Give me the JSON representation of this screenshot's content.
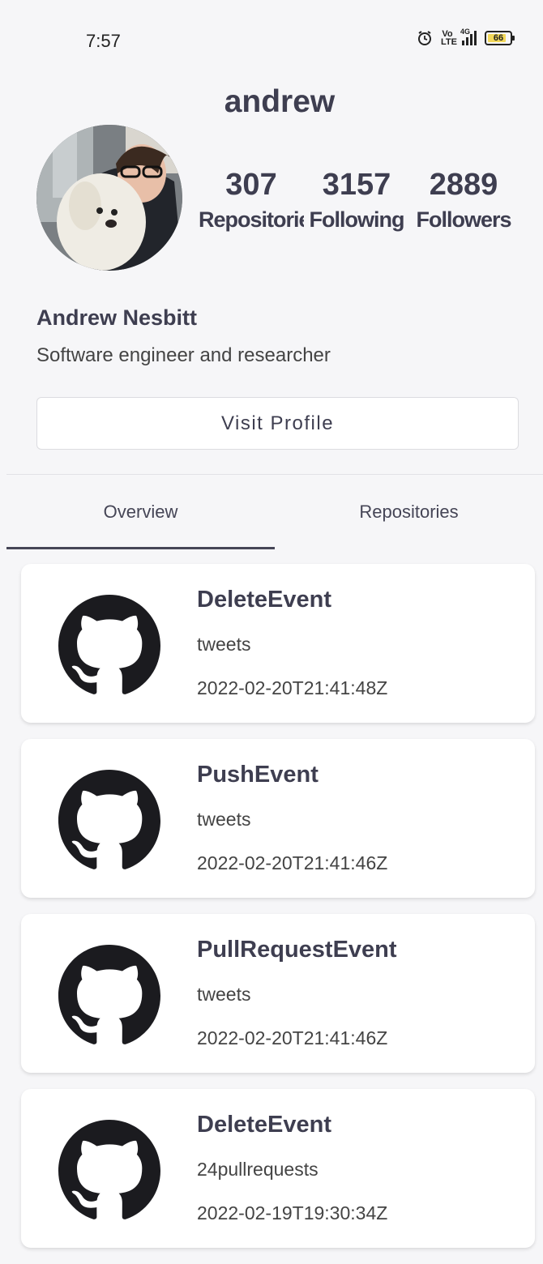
{
  "status_bar": {
    "time": "7:57",
    "volte": "Vo\nLTE",
    "network": "4G",
    "battery": "66"
  },
  "profile": {
    "username": "andrew",
    "stats": [
      {
        "value": "307",
        "label": "Repositories"
      },
      {
        "value": "3157",
        "label": "Following"
      },
      {
        "value": "2889",
        "label": "Followers"
      }
    ],
    "full_name": "Andrew Nesbitt",
    "bio": "Software engineer and researcher",
    "visit_label": "Visit Profile"
  },
  "tabs": [
    {
      "label": "Overview",
      "active": true
    },
    {
      "label": "Repositories",
      "active": false
    }
  ],
  "events": [
    {
      "type": "DeleteEvent",
      "repo": "tweets",
      "date": "2022-02-20T21:41:48Z"
    },
    {
      "type": "PushEvent",
      "repo": "tweets",
      "date": "2022-02-20T21:41:46Z"
    },
    {
      "type": "PullRequestEvent",
      "repo": "tweets",
      "date": "2022-02-20T21:41:46Z"
    },
    {
      "type": "DeleteEvent",
      "repo": "24pullrequests",
      "date": "2022-02-19T19:30:34Z"
    }
  ],
  "icons": {
    "event_icon": "github-octocat-icon",
    "avatar": "profile-photo"
  },
  "colors": {
    "background": "#f6f6f8",
    "text": "#3e3e50",
    "card": "#ffffff",
    "icon": "#1b1b1f"
  }
}
